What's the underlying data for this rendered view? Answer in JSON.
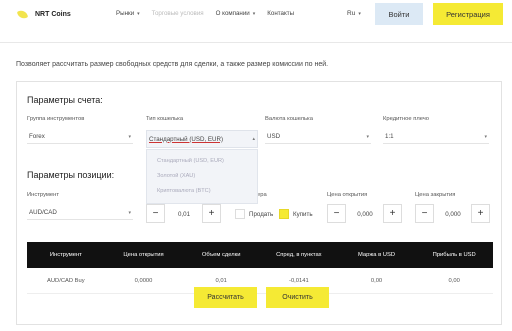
{
  "header": {
    "logo_text": "NRT Coins",
    "nav": [
      {
        "label": "Рынки",
        "has_chevron": true,
        "muted": false
      },
      {
        "label": "Торговые условия",
        "has_chevron": false,
        "muted": true
      },
      {
        "label": "О компании",
        "has_chevron": true,
        "muted": false
      },
      {
        "label": "Контакты",
        "has_chevron": false,
        "muted": false
      }
    ],
    "language": "Ru",
    "login_label": "Войти",
    "register_label": "Регистрация"
  },
  "intro_text": "Позволяет рассчитать размер свободных средств для сделки, а также размер комиссии по ней.",
  "account": {
    "title": "Параметры счета:",
    "instrument_group_label": "Группа инструментов",
    "instrument_group_value": "Forex",
    "wallet_type_label": "Тип кошелька",
    "wallet_type_value": "Стандартный (USD, EUR)",
    "wallet_currency_label": "Валюта кошелька",
    "wallet_currency_value": "USD",
    "leverage_label": "Кредитное плечо",
    "leverage_value": "1:1",
    "wallet_options": [
      "Стандартный (USD, EUR)",
      "Золотой (XAU)",
      "Криптовалюта (BTC)"
    ]
  },
  "position": {
    "title": "Параметры позиции:",
    "instrument_label": "Инструмент",
    "instrument_value": "AUD/CAD",
    "volume_value": "0,01",
    "direction_partial_label": "ера",
    "sell_label": "Продать",
    "buy_label": "Купить",
    "open_price_label": "Цена открытия",
    "open_price_value": "0,000",
    "close_price_label": "Цена закрытия",
    "close_price_value": "0,000",
    "minus": "−",
    "plus": "+"
  },
  "table": {
    "headers": [
      "Инструмент",
      "Цена открытия",
      "Объем сделки",
      "Спред, в пунктах",
      "Маржа в USD",
      "Прибыль в USD"
    ],
    "row": [
      "AUD/CAD Buy",
      "0,0000",
      "0,01",
      "-0,0141",
      "0,00",
      "0,00"
    ]
  },
  "calc_label": "Рассчитать",
  "clear_label": "Очистить"
}
